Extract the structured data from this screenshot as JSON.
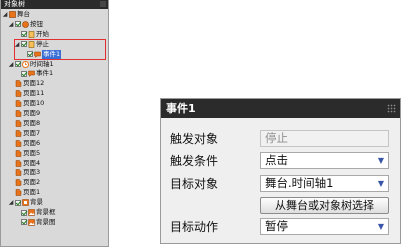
{
  "tree": {
    "title": "对象树",
    "items": [
      {
        "label": "舞台",
        "depth": 0,
        "expanded": true,
        "checkbox": false,
        "icon": "stage-icon"
      },
      {
        "label": "按钮",
        "depth": 1,
        "expanded": true,
        "checkbox": true,
        "icon": "button-icon"
      },
      {
        "label": "开始",
        "depth": 2,
        "expanded": false,
        "checkbox": true,
        "icon": "state-icon"
      },
      {
        "label": "停止",
        "depth": 2,
        "expanded": true,
        "checkbox": true,
        "icon": "state-icon"
      },
      {
        "label": "事件1",
        "depth": 3,
        "expanded": false,
        "checkbox": true,
        "icon": "event-icon",
        "selected": true
      },
      {
        "label": "时间轴1",
        "depth": 1,
        "expanded": true,
        "checkbox": true,
        "icon": "timeline-icon"
      },
      {
        "label": "事件1",
        "depth": 2,
        "expanded": false,
        "checkbox": true,
        "icon": "event-icon"
      },
      {
        "label": "页面12",
        "depth": 1,
        "checkbox": false,
        "icon": "page-icon"
      },
      {
        "label": "页面11",
        "depth": 1,
        "checkbox": false,
        "icon": "page-icon"
      },
      {
        "label": "页面10",
        "depth": 1,
        "checkbox": false,
        "icon": "page-icon"
      },
      {
        "label": "页面9",
        "depth": 1,
        "checkbox": false,
        "icon": "page-icon"
      },
      {
        "label": "页面8",
        "depth": 1,
        "checkbox": false,
        "icon": "page-icon"
      },
      {
        "label": "页面7",
        "depth": 1,
        "checkbox": false,
        "icon": "page-icon"
      },
      {
        "label": "页面6",
        "depth": 1,
        "checkbox": false,
        "icon": "page-icon"
      },
      {
        "label": "页面5",
        "depth": 1,
        "checkbox": false,
        "icon": "page-icon"
      },
      {
        "label": "页面4",
        "depth": 1,
        "checkbox": false,
        "icon": "page-icon"
      },
      {
        "label": "页面3",
        "depth": 1,
        "checkbox": false,
        "icon": "page-icon"
      },
      {
        "label": "页面2",
        "depth": 1,
        "checkbox": false,
        "icon": "page-icon"
      },
      {
        "label": "页面1",
        "depth": 1,
        "checkbox": false,
        "icon": "page-icon"
      },
      {
        "label": "背景",
        "depth": 1,
        "expanded": true,
        "checkbox": true,
        "icon": "background-icon"
      },
      {
        "label": "背景框",
        "depth": 2,
        "checkbox": true,
        "icon": "image-icon"
      },
      {
        "label": "背景图",
        "depth": 2,
        "checkbox": true,
        "icon": "image-icon"
      }
    ]
  },
  "props": {
    "title": "事件1",
    "trigger_object_label": "触发对象",
    "trigger_object_value": "停止",
    "trigger_condition_label": "触发条件",
    "trigger_condition_value": "点击",
    "target_object_label": "目标对象",
    "target_object_value": "舞台.时间轴1",
    "pick_button_label": "从舞台或对象树选择",
    "target_action_label": "目标动作",
    "target_action_value": "暂停"
  },
  "colors": {
    "header_bg": "#2b2b2b",
    "highlight_border": "#e03030",
    "selection_bg": "#3a6fd6",
    "icon_orange": "#e8731a"
  }
}
